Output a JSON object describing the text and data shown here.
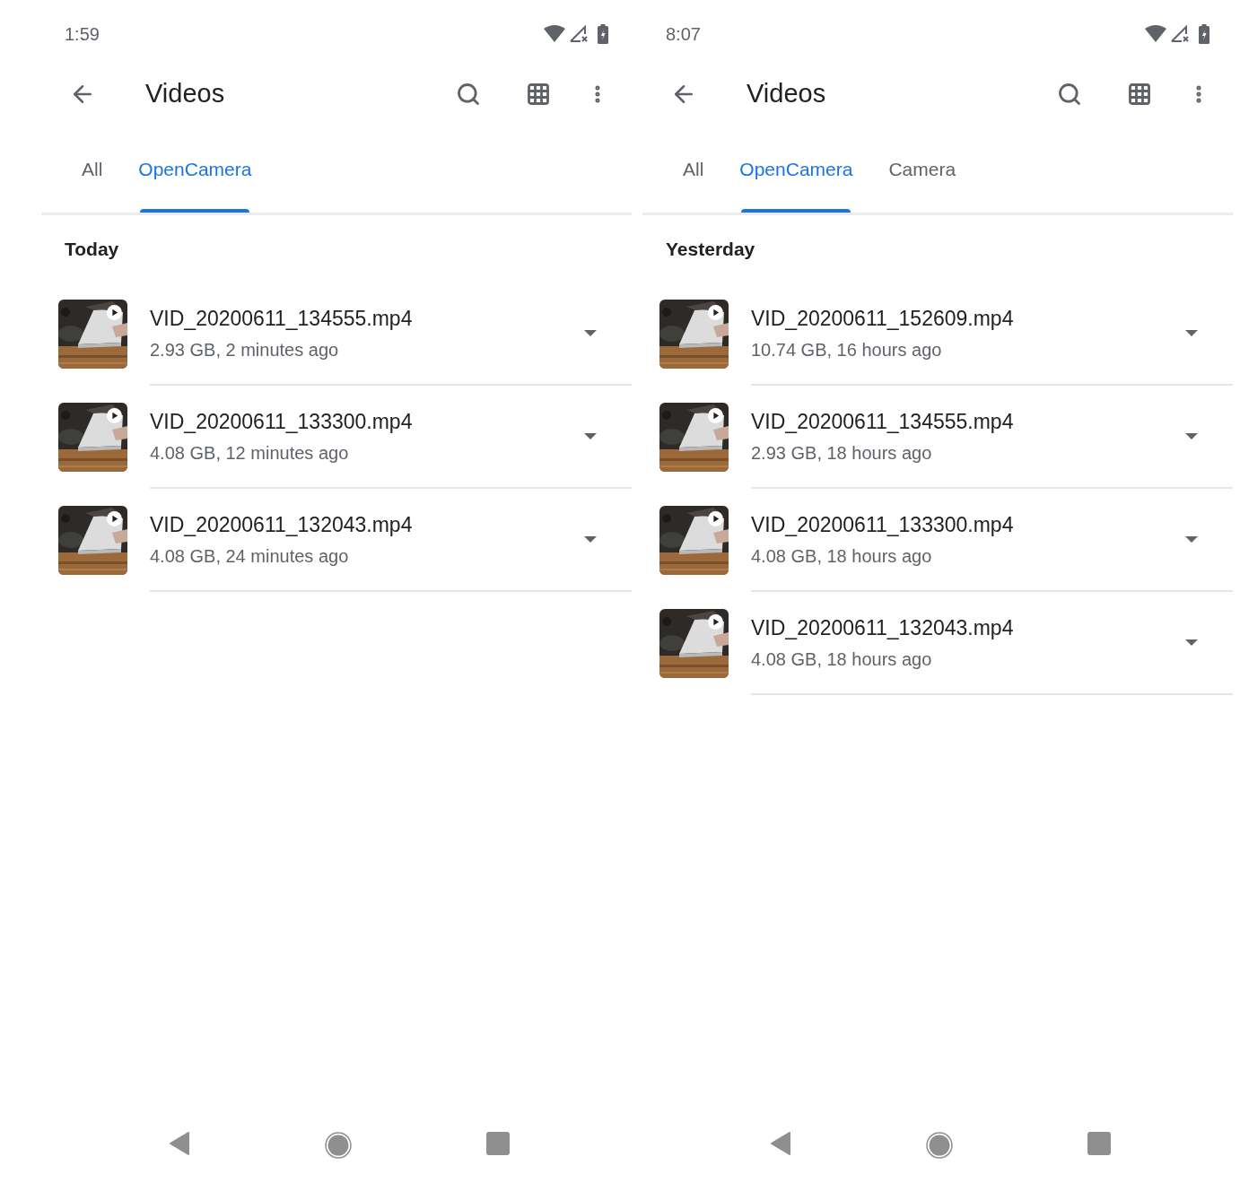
{
  "screens": [
    {
      "status_bar": {
        "time": "1:59"
      },
      "toolbar": {
        "title": "Videos"
      },
      "tabs": [
        {
          "label": "All",
          "selected": false
        },
        {
          "label": "OpenCamera",
          "selected": true
        }
      ],
      "section": "Today",
      "videos": [
        {
          "name": "VID_20200611_134555.mp4",
          "details": "2.93 GB, 2 minutes ago"
        },
        {
          "name": "VID_20200611_133300.mp4",
          "details": "4.08 GB, 12 minutes ago"
        },
        {
          "name": "VID_20200611_132043.mp4",
          "details": "4.08 GB, 24 minutes ago"
        }
      ]
    },
    {
      "status_bar": {
        "time": "8:07"
      },
      "toolbar": {
        "title": "Videos"
      },
      "tabs": [
        {
          "label": "All",
          "selected": false
        },
        {
          "label": "OpenCamera",
          "selected": true
        },
        {
          "label": "Camera",
          "selected": false
        }
      ],
      "section": "Yesterday",
      "videos": [
        {
          "name": "VID_20200611_152609.mp4",
          "details": "10.74 GB, 16 hours ago"
        },
        {
          "name": "VID_20200611_134555.mp4",
          "details": "2.93 GB, 18 hours ago"
        },
        {
          "name": "VID_20200611_133300.mp4",
          "details": "4.08 GB, 18 hours ago"
        },
        {
          "name": "VID_20200611_132043.mp4",
          "details": "4.08 GB, 18 hours ago"
        }
      ]
    }
  ]
}
